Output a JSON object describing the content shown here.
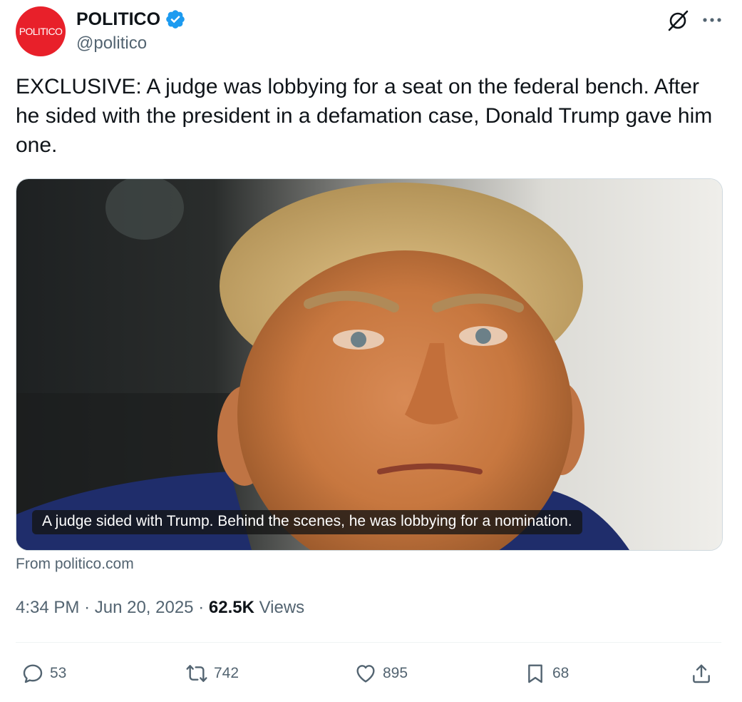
{
  "author": {
    "logo_text": "POLITICO",
    "name": "POLITICO",
    "handle": "@politico",
    "verified": true
  },
  "tweet": {
    "text": "EXCLUSIVE: A judge was lobbying for a seat on the federal bench. After he sided with the president in a defamation case, Donald Trump gave him one."
  },
  "card": {
    "caption": "A judge sided with Trump. Behind the scenes, he was lobbying for a nomination.",
    "source": "From politico.com"
  },
  "meta": {
    "time": "4:34 PM",
    "date": "Jun 20, 2025",
    "views_count": "62.5K",
    "views_label": "Views",
    "separator": "·"
  },
  "actions": {
    "replies": "53",
    "reposts": "742",
    "likes": "895",
    "bookmarks": "68"
  },
  "icons": {
    "grok": "grok-icon",
    "more": "more-icon",
    "reply": "reply-icon",
    "repost": "repost-icon",
    "like": "heart-icon",
    "bookmark": "bookmark-icon",
    "share": "share-icon",
    "verified": "verified-badge-icon"
  },
  "colors": {
    "brand_red": "#e8202a",
    "verified_blue": "#1d9bf0",
    "text_primary": "#0f1419",
    "text_secondary": "#536471"
  }
}
